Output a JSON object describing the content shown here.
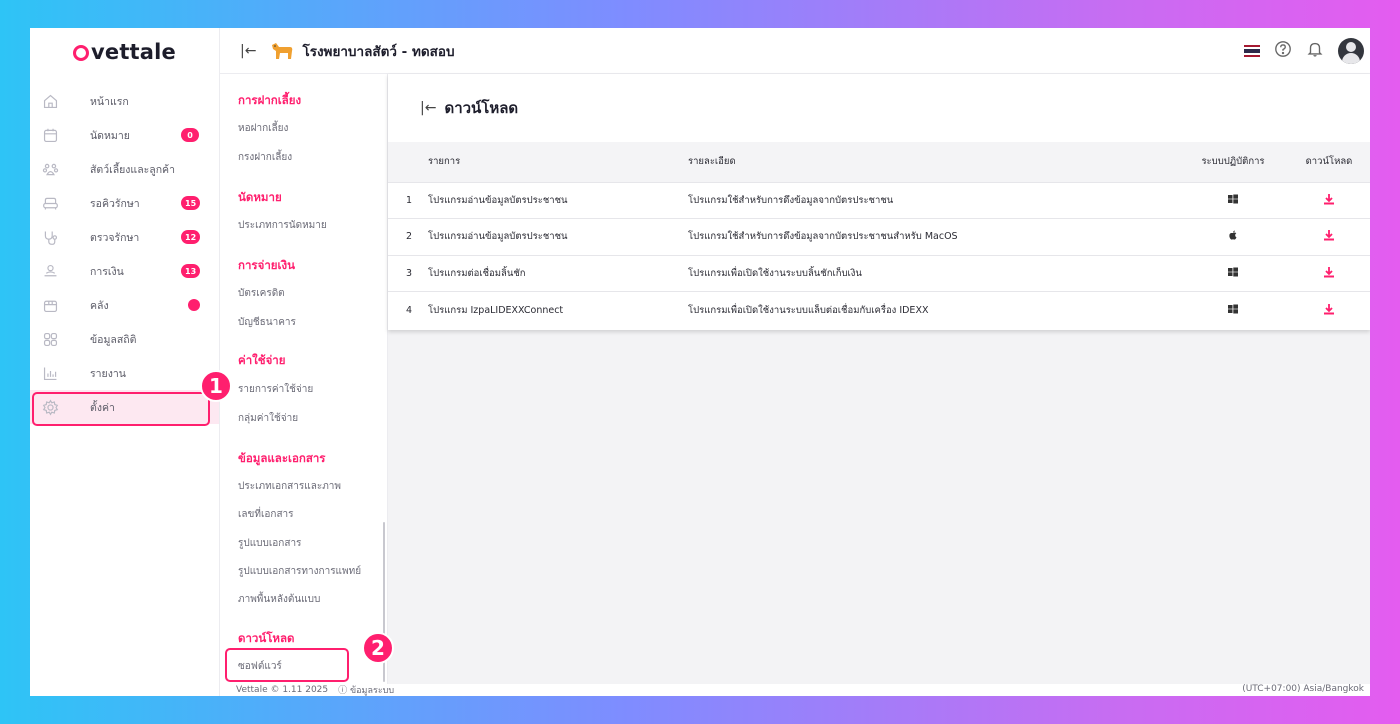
{
  "brand": {
    "logo_text": "vettale",
    "accent": "#ff1f6e"
  },
  "header": {
    "clinic_name": "โรงพยาบาลสัตว์ - ทดสอบ",
    "collapse_icon": "collapse-icon"
  },
  "sidebar": {
    "items": [
      {
        "label": "หน้าแรก",
        "icon": "home-icon"
      },
      {
        "label": "นัดหมาย",
        "icon": "calendar-icon",
        "badge": "0"
      },
      {
        "label": "สัตว์เลี้ยงและลูกค้า",
        "icon": "paw-icon"
      },
      {
        "label": "รอคิวรักษา",
        "icon": "sofa-icon",
        "badge": "15"
      },
      {
        "label": "ตรวจรักษา",
        "icon": "stethoscope-icon",
        "badge": "12"
      },
      {
        "label": "การเงิน",
        "icon": "money-icon",
        "badge": "13"
      },
      {
        "label": "คลัง",
        "icon": "box-icon",
        "dot": true
      },
      {
        "label": "ข้อมูลสถิติ",
        "icon": "grid-icon"
      },
      {
        "label": "รายงาน",
        "icon": "chart-icon"
      },
      {
        "label": "ตั้งค่า",
        "icon": "gear-icon",
        "active": true
      }
    ]
  },
  "markers": {
    "one": "1",
    "two": "2"
  },
  "submenu": {
    "sections": [
      {
        "title": "การฝากเลี้ยง",
        "items": [
          "หอฝากเลี้ยง",
          "กรงฝากเลี้ยง"
        ]
      },
      {
        "title": "นัดหมาย",
        "items": [
          "ประเภทการนัดหมาย"
        ]
      },
      {
        "title": "การจ่ายเงิน",
        "items": [
          "บัตรเครดิต",
          "บัญชีธนาคาร"
        ]
      },
      {
        "title": "ค่าใช้จ่าย",
        "items": [
          "รายการค่าใช้จ่าย",
          "กลุ่มค่าใช้จ่าย"
        ]
      },
      {
        "title": "ข้อมูลและเอกสาร",
        "items": [
          "ประเภทเอกสารและภาพ",
          "เลขที่เอกสาร",
          "รูปแบบเอกสาร",
          "รูปแบบเอกสารทางการแพทย์",
          "ภาพพื้นหลังต้นแบบ"
        ]
      },
      {
        "title": "ดาวน์โหลด",
        "items": [
          "ซอฟต์แวร์"
        ]
      }
    ]
  },
  "page": {
    "title": "ดาวน์โหลด",
    "columns": {
      "name": "รายการ",
      "desc": "รายละเอียด",
      "os": "ระบบปฏิบัติการ",
      "download": "ดาวน์โหลด"
    },
    "rows": [
      {
        "no": "1",
        "name": "โปรแกรมอ่านข้อมูลบัตรประชาชน",
        "desc": "โปรแกรมใช้สำหรับการดึงข้อมูลจากบัตรประชาชน",
        "os": "windows-icon"
      },
      {
        "no": "2",
        "name": "โปรแกรมอ่านข้อมูลบัตรประชาชน",
        "desc": "โปรแกรมใช้สำหรับการดึงข้อมูลจากบัตรประชาชนสำหรับ MacOS",
        "os": "apple-icon"
      },
      {
        "no": "3",
        "name": "โปรแกรมต่อเชื่อมลิ้นชัก",
        "desc": "โปรแกรมเพื่อเปิดใช้งานระบบลิ้นชักเก็บเงิน",
        "os": "windows-icon"
      },
      {
        "no": "4",
        "name": "โปรแกรม IzpaLIDEXXConnect",
        "desc": "โปรแกรมเพื่อเปิดใช้งานระบบแล็บต่อเชื่อมกับเครื่อง IDEXX",
        "os": "windows-icon"
      }
    ]
  },
  "footer": {
    "version": "Vettale © 1.11 2025",
    "sysinfo": "ⓘ ข้อมูลระบบ",
    "timezone": "(UTC+07:00) Asia/Bangkok"
  }
}
